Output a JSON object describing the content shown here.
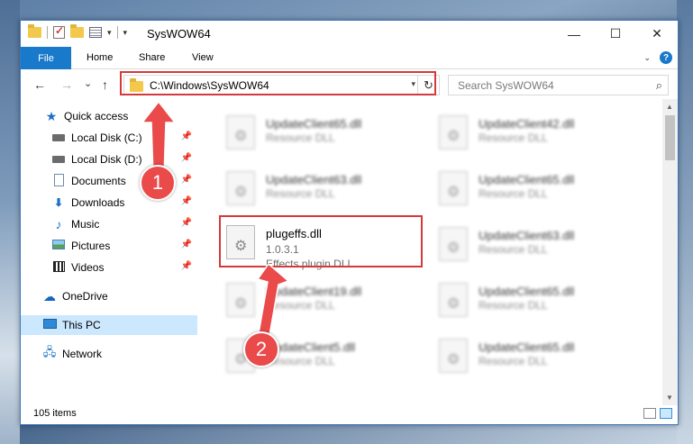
{
  "window": {
    "title": "SysWOW64",
    "controls": {
      "minimize": "—",
      "maximize": "☐",
      "close": "✕"
    }
  },
  "ribbon": {
    "tabs": [
      "File",
      "Home",
      "Share",
      "View"
    ],
    "help": "?"
  },
  "navigation": {
    "back": "←",
    "forward": "→",
    "recent": "⌄",
    "up": "↑",
    "address": "C:\\Windows\\SysWOW64",
    "refresh": "↻",
    "search_placeholder": "Search SysWOW64"
  },
  "sidebar": {
    "items": [
      {
        "label": "Quick access",
        "icon": "star-icon"
      },
      {
        "label": "Local Disk (C:)",
        "icon": "disk-icon",
        "pinned": true
      },
      {
        "label": "Local Disk (D:)",
        "icon": "disk-icon",
        "pinned": true
      },
      {
        "label": "Documents",
        "icon": "documents-icon",
        "pinned": true
      },
      {
        "label": "Downloads",
        "icon": "downloads-icon",
        "pinned": true
      },
      {
        "label": "Music",
        "icon": "music-icon",
        "pinned": true
      },
      {
        "label": "Pictures",
        "icon": "pictures-icon",
        "pinned": true
      },
      {
        "label": "Videos",
        "icon": "videos-icon",
        "pinned": true
      },
      {
        "label": "OneDrive",
        "icon": "cloud-icon"
      },
      {
        "label": "This PC",
        "icon": "pc-icon",
        "selected": true
      },
      {
        "label": "Network",
        "icon": "network-icon"
      }
    ]
  },
  "files": [
    {
      "name": "UpdateClient65.dll",
      "type": "Resource DLL",
      "blurred": true
    },
    {
      "name": "UpdateClient42.dll",
      "type": "Resource DLL",
      "blurred": true
    },
    {
      "name": "UpdateClient63.dll",
      "type": "Resource DLL",
      "blurred": true
    },
    {
      "name": "UpdateClient65.dll",
      "type": "Resource DLL",
      "blurred": true
    },
    {
      "name": "plugeffs.dll",
      "version": "1.0.3.1",
      "type": "Effects plugin DLL",
      "blurred": false
    },
    {
      "name": "UpdateClient63.dll",
      "type": "Resource DLL",
      "blurred": true
    },
    {
      "name": "UpdateClient19.dll",
      "type": "Resource DLL",
      "blurred": true
    },
    {
      "name": "UpdateClient65.dll",
      "type": "Resource DLL",
      "blurred": true
    },
    {
      "name": "UpdateClient5.dll",
      "type": "Resource DLL",
      "blurred": true
    },
    {
      "name": "UpdateClient65.dll",
      "type": "Resource DLL",
      "blurred": true
    }
  ],
  "status": {
    "items_count": "105 items"
  },
  "annotations": {
    "marker1": "1",
    "marker2": "2",
    "color": "#ea4a4a"
  }
}
